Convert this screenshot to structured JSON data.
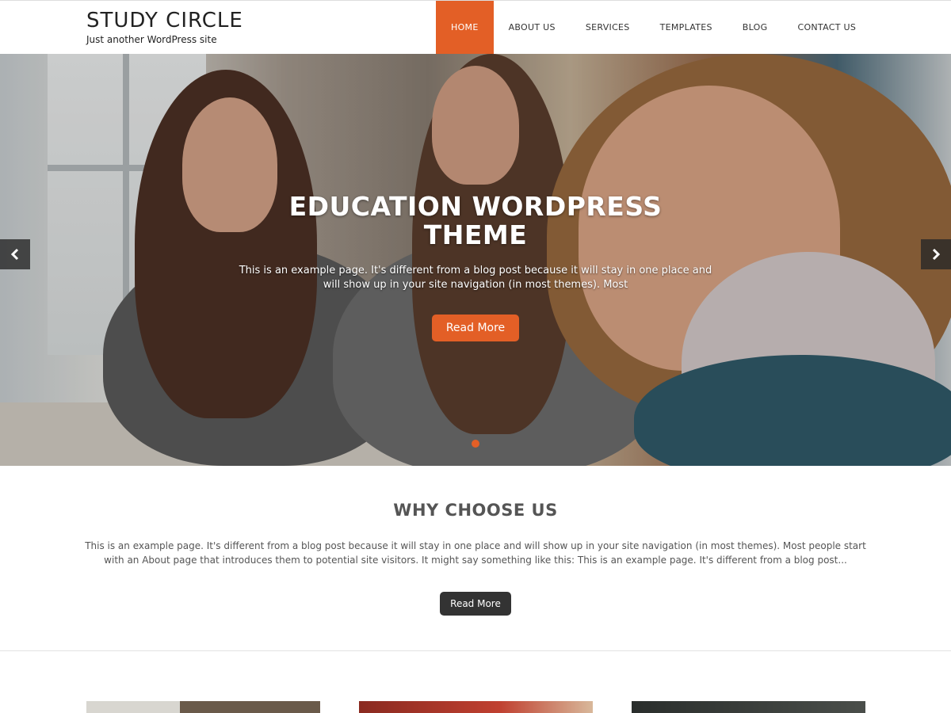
{
  "header": {
    "site_title": "STUDY CIRCLE",
    "tagline": "Just another WordPress site",
    "nav": [
      {
        "label": "HOME",
        "active": true
      },
      {
        "label": "ABOUT US"
      },
      {
        "label": "SERVICES"
      },
      {
        "label": "TEMPLATES"
      },
      {
        "label": "BLOG"
      },
      {
        "label": "CONTACT US"
      }
    ]
  },
  "hero": {
    "title": "EDUCATION WORDPRESS THEME",
    "text": "This is an example page. It's different from a blog post because it will stay in one place and will show up in your site navigation (in most themes). Most",
    "button": "Read More",
    "prev_icon": "chevron-left-icon",
    "next_icon": "chevron-right-icon",
    "active_slide": 1,
    "slide_count": 1
  },
  "why": {
    "title": "WHY CHOOSE US",
    "text": "This is an example page. It's different from a blog post because it will stay in one place and will show up in your site navigation (in most themes). Most people start with an About page that introduces them to potential site visitors. It might say something like this: This is an example page. It's different from a blog post...",
    "button": "Read More"
  },
  "colors": {
    "accent": "#e35f26",
    "dark_button": "#333333"
  }
}
